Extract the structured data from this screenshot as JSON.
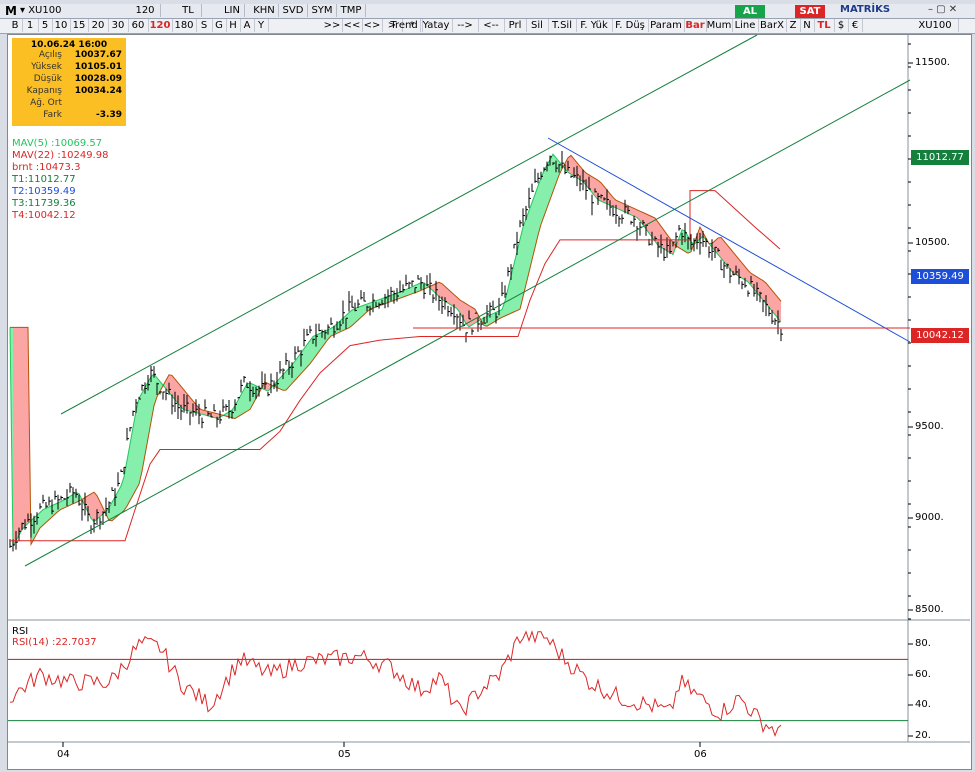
{
  "toolbar1": {
    "logo": "M",
    "symbol": "XU100",
    "periods": [
      "B",
      "1",
      "5",
      "10",
      "15",
      "20",
      "30",
      "60",
      "120",
      "180",
      "S",
      "G",
      "H",
      "A",
      "Y"
    ],
    "active_period": "120",
    "interval": "120",
    "currency": "TL",
    "scale": "LIN",
    "tabs": [
      "KHN",
      "SVD",
      "SYM",
      "TMP"
    ],
    "nav": [
      ">>",
      "<<",
      "<>",
      ">",
      "*"
    ],
    "tools": [
      "Trend",
      "Yatay",
      "-->",
      "<--",
      "Prl",
      "Sil",
      "T.Sil",
      "F. Yük",
      "F. Düş",
      "Param",
      "Bar",
      "Mum",
      "Line",
      "BarX",
      "Z",
      "N",
      "TL",
      "$",
      "€"
    ],
    "buy_label": "AL",
    "sell_label": "SAT",
    "brand": "MATRİKS",
    "right_symbol": "XU100"
  },
  "info": {
    "date": "10.06.24 16:00",
    "rows": [
      {
        "k": "Açılış",
        "v": "10037.67"
      },
      {
        "k": "Yüksek",
        "v": "10105.01"
      },
      {
        "k": "Düşük",
        "v": "10028.09"
      },
      {
        "k": "Kapanış",
        "v": "10034.24"
      },
      {
        "k": "Ağ. Ort",
        "v": ""
      },
      {
        "k": "Fark",
        "v": "-3.39"
      }
    ]
  },
  "legend": [
    {
      "text": "MAV(5)      :10069.57",
      "color": "#22c55e"
    },
    {
      "text": "MAV(22)     :10249.98",
      "color": "#dc2626"
    },
    {
      "text": "brnt        :10473.3",
      "color": "#dc2626"
    },
    {
      "text": "T1:11012.77",
      "color": "#15803d"
    },
    {
      "text": "T2:10359.49",
      "color": "#1d4ed8"
    },
    {
      "text": "T3:11739.36",
      "color": "#15803d"
    },
    {
      "text": "T4:10042.12",
      "color": "#dc2626"
    }
  ],
  "price_axis": [
    "11500.",
    "10500.",
    "9500.",
    "9000.",
    "8500."
  ],
  "price_badges": [
    {
      "label": "10042.12",
      "color": "#dc2626"
    },
    {
      "label": "10359.49",
      "color": "#1d4ed8"
    },
    {
      "label": "11012.77",
      "color": "#15803d"
    }
  ],
  "x_axis": [
    "04",
    "05",
    "06"
  ],
  "rsi": {
    "title": "RSI",
    "label": "RSI(14)      :22.7037",
    "axis": [
      "80.",
      "60.",
      "40.",
      "20."
    ]
  },
  "colors": {
    "buy": "#16a34a",
    "sell": "#dc2626",
    "green_fill": "#86efac",
    "red_fill": "#fca5a5"
  }
}
